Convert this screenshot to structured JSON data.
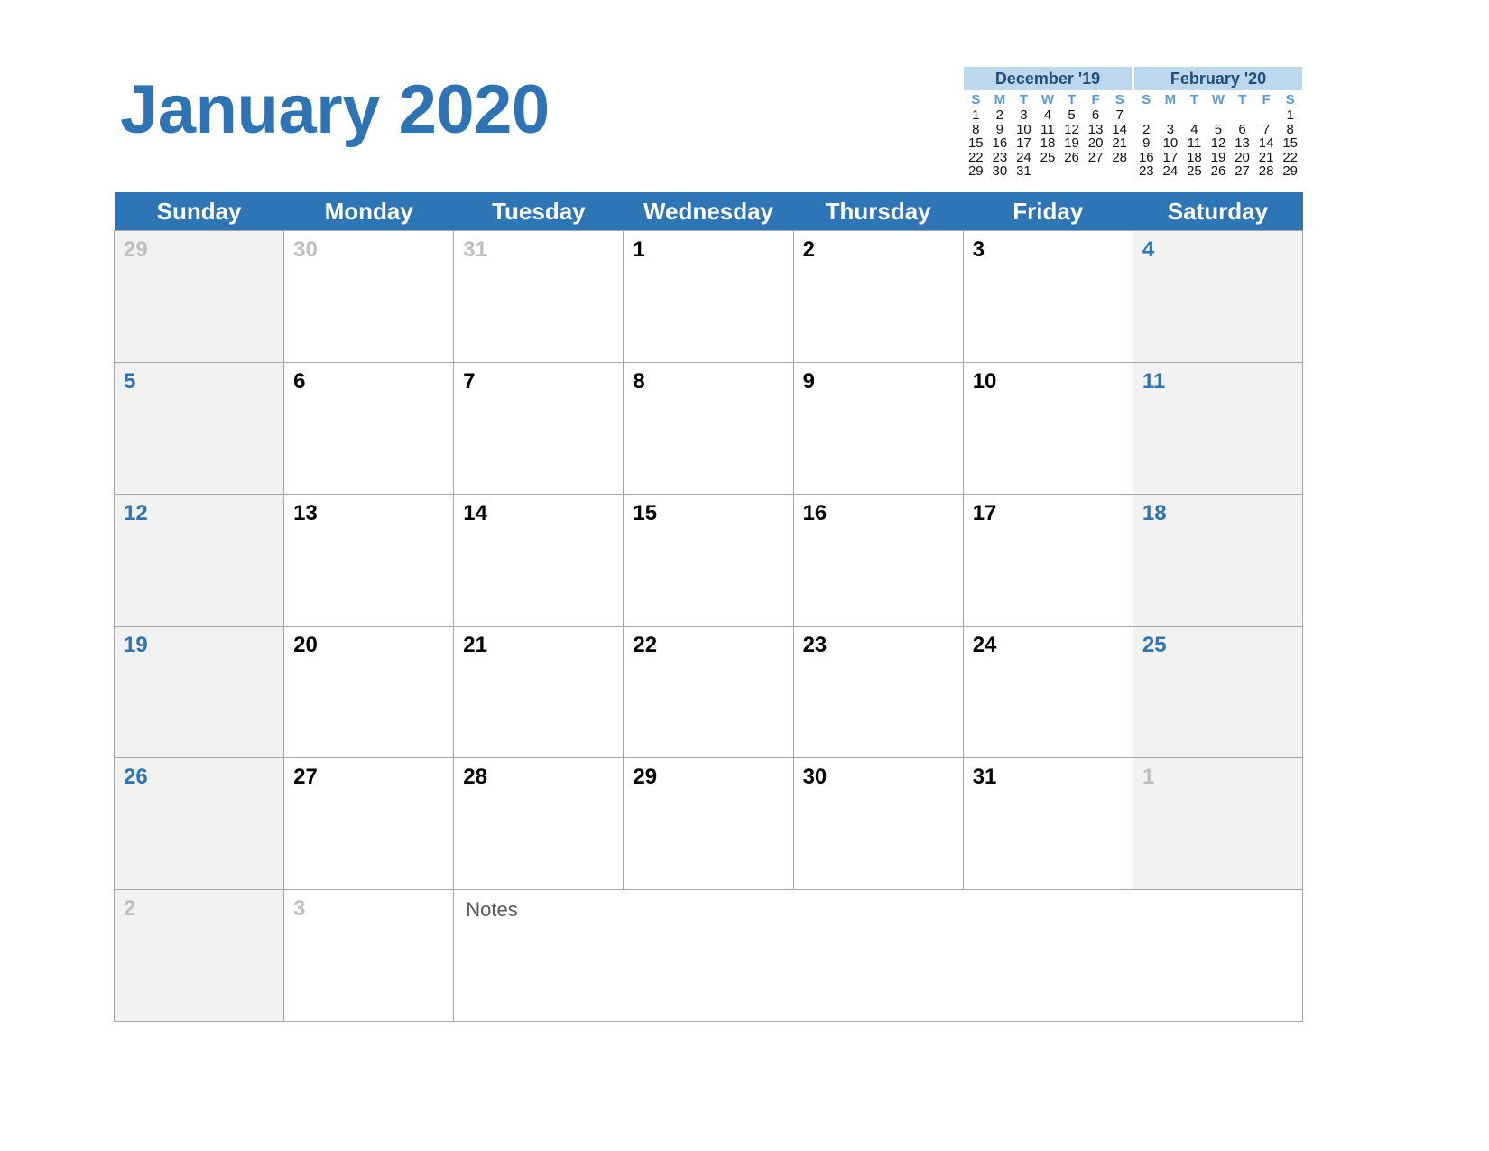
{
  "page_title": "January 2020",
  "accent_colors": {
    "title_blue": "#2E74B5",
    "header_band_blue": "#2E75B6",
    "mini_header_blue": "#BDD7EE",
    "mini_title_text": "#1F4E79",
    "mini_dow_blue": "#5B9BD5",
    "weekend_cell_gray": "#F2F2F2",
    "out_of_month_gray": "#BFBFBF",
    "grid_line_gray": "#A6A6A6",
    "notes_text_gray": "#595959"
  },
  "mini_calendars": [
    {
      "id": "prev",
      "title": "December '19",
      "dow": [
        "S",
        "M",
        "T",
        "W",
        "T",
        "F",
        "S"
      ],
      "weeks": [
        [
          "1",
          "2",
          "3",
          "4",
          "5",
          "6",
          "7"
        ],
        [
          "8",
          "9",
          "10",
          "11",
          "12",
          "13",
          "14"
        ],
        [
          "15",
          "16",
          "17",
          "18",
          "19",
          "20",
          "21"
        ],
        [
          "22",
          "23",
          "24",
          "25",
          "26",
          "27",
          "28"
        ],
        [
          "29",
          "30",
          "31",
          "",
          "",
          "",
          ""
        ]
      ]
    },
    {
      "id": "next",
      "title": "February '20",
      "dow": [
        "S",
        "M",
        "T",
        "W",
        "T",
        "F",
        "S"
      ],
      "weeks": [
        [
          "",
          "",
          "",
          "",
          "",
          "",
          "1"
        ],
        [
          "2",
          "3",
          "4",
          "5",
          "6",
          "7",
          "8"
        ],
        [
          "9",
          "10",
          "11",
          "12",
          "13",
          "14",
          "15"
        ],
        [
          "16",
          "17",
          "18",
          "19",
          "20",
          "21",
          "22"
        ],
        [
          "23",
          "24",
          "25",
          "26",
          "27",
          "28",
          "29"
        ]
      ]
    }
  ],
  "day_headers": [
    "Sunday",
    "Monday",
    "Tuesday",
    "Wednesday",
    "Thursday",
    "Friday",
    "Saturday"
  ],
  "weeks": [
    [
      {
        "num": "29",
        "out_of_month": true,
        "weekend": true
      },
      {
        "num": "30",
        "out_of_month": true,
        "weekend": false
      },
      {
        "num": "31",
        "out_of_month": true,
        "weekend": false
      },
      {
        "num": "1",
        "out_of_month": false,
        "weekend": false
      },
      {
        "num": "2",
        "out_of_month": false,
        "weekend": false
      },
      {
        "num": "3",
        "out_of_month": false,
        "weekend": false
      },
      {
        "num": "4",
        "out_of_month": false,
        "weekend": true
      }
    ],
    [
      {
        "num": "5",
        "out_of_month": false,
        "weekend": true
      },
      {
        "num": "6",
        "out_of_month": false,
        "weekend": false
      },
      {
        "num": "7",
        "out_of_month": false,
        "weekend": false
      },
      {
        "num": "8",
        "out_of_month": false,
        "weekend": false
      },
      {
        "num": "9",
        "out_of_month": false,
        "weekend": false
      },
      {
        "num": "10",
        "out_of_month": false,
        "weekend": false
      },
      {
        "num": "11",
        "out_of_month": false,
        "weekend": true
      }
    ],
    [
      {
        "num": "12",
        "out_of_month": false,
        "weekend": true
      },
      {
        "num": "13",
        "out_of_month": false,
        "weekend": false
      },
      {
        "num": "14",
        "out_of_month": false,
        "weekend": false
      },
      {
        "num": "15",
        "out_of_month": false,
        "weekend": false
      },
      {
        "num": "16",
        "out_of_month": false,
        "weekend": false
      },
      {
        "num": "17",
        "out_of_month": false,
        "weekend": false
      },
      {
        "num": "18",
        "out_of_month": false,
        "weekend": true
      }
    ],
    [
      {
        "num": "19",
        "out_of_month": false,
        "weekend": true
      },
      {
        "num": "20",
        "out_of_month": false,
        "weekend": false
      },
      {
        "num": "21",
        "out_of_month": false,
        "weekend": false
      },
      {
        "num": "22",
        "out_of_month": false,
        "weekend": false
      },
      {
        "num": "23",
        "out_of_month": false,
        "weekend": false
      },
      {
        "num": "24",
        "out_of_month": false,
        "weekend": false
      },
      {
        "num": "25",
        "out_of_month": false,
        "weekend": true
      }
    ],
    [
      {
        "num": "26",
        "out_of_month": false,
        "weekend": true
      },
      {
        "num": "27",
        "out_of_month": false,
        "weekend": false
      },
      {
        "num": "28",
        "out_of_month": false,
        "weekend": false
      },
      {
        "num": "29",
        "out_of_month": false,
        "weekend": false
      },
      {
        "num": "30",
        "out_of_month": false,
        "weekend": false
      },
      {
        "num": "31",
        "out_of_month": false,
        "weekend": false
      },
      {
        "num": "1",
        "out_of_month": true,
        "weekend": true
      }
    ]
  ],
  "final_row": {
    "cells": [
      {
        "num": "2",
        "out_of_month": true,
        "weekend": true
      },
      {
        "num": "3",
        "out_of_month": true,
        "weekend": false
      }
    ],
    "notes_label": "Notes",
    "notes_colspan": 5
  }
}
